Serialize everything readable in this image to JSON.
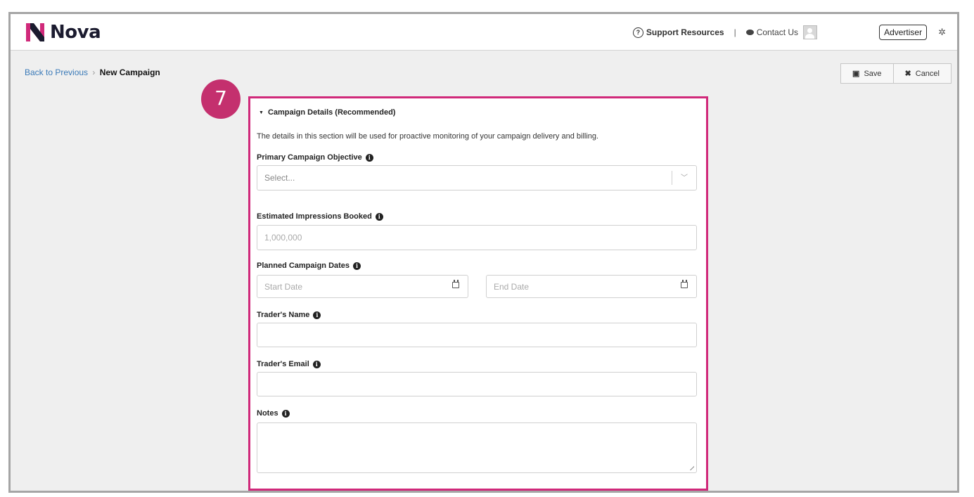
{
  "header": {
    "logo_text": "Nova",
    "support_label": "Support Resources",
    "separator": "|",
    "contact_label": "Contact Us",
    "role_label": "Advertiser"
  },
  "breadcrumb": {
    "back_label": "Back to Previous",
    "separator": "›",
    "current": "New Campaign"
  },
  "actions": {
    "save_label": "Save",
    "cancel_label": "Cancel"
  },
  "step_number": "7",
  "section": {
    "title": "Campaign Details (Recommended)",
    "description": "The details in this section will be used for proactive monitoring of your campaign delivery and billing.",
    "objective_label": "Primary Campaign Objective",
    "objective_placeholder": "Select...",
    "impressions_label": "Estimated Impressions Booked",
    "impressions_placeholder": "1,000,000",
    "dates_label": "Planned Campaign Dates",
    "start_placeholder": "Start Date",
    "end_placeholder": "End Date",
    "trader_name_label": "Trader's Name",
    "trader_name_value": "",
    "trader_email_label": "Trader's Email",
    "trader_email_value": "",
    "notes_label": "Notes",
    "notes_value": ""
  },
  "colors": {
    "brand": "#1b1b2f",
    "accent_pink": "#d0297a",
    "badge": "#c4306e",
    "link": "#3a7ab8",
    "background": "#efefef"
  },
  "icons": [
    "nova-logo-icon",
    "help-circle-icon",
    "chat-bubble-icon",
    "user-avatar-icon",
    "gear-icon",
    "save-icon",
    "close-icon",
    "caret-down-icon",
    "info-icon",
    "chevron-down-icon",
    "calendar-icon"
  ]
}
